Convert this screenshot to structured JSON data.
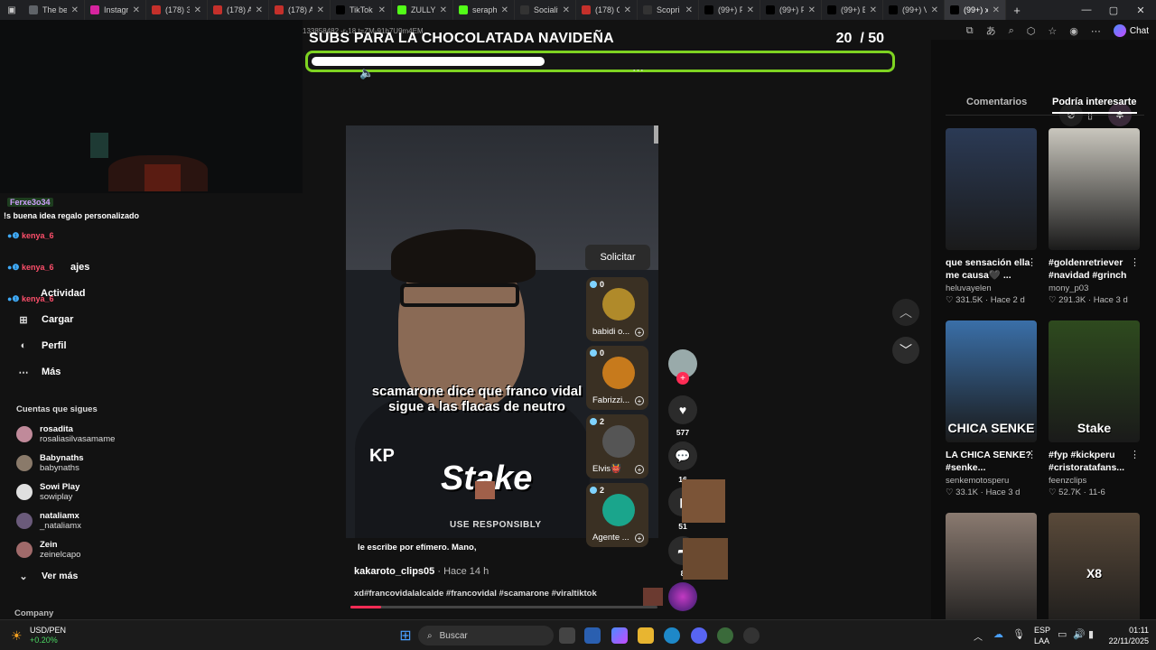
{
  "browser": {
    "tabs": [
      {
        "label": "The be",
        "color": "#5f6368"
      },
      {
        "label": "Instagra",
        "color": "#d6249f"
      },
      {
        "label": "(178) 3",
        "color": "#c4302b"
      },
      {
        "label": "(178) Al",
        "color": "#c4302b"
      },
      {
        "label": "(178) Al",
        "color": "#c4302b"
      },
      {
        "label": "TikTok -",
        "color": "#000000"
      },
      {
        "label": "ZULLY",
        "color": "#53fc18"
      },
      {
        "label": "seraphi",
        "color": "#53fc18"
      },
      {
        "label": "Socialit",
        "color": "#333333"
      },
      {
        "label": "(178) C",
        "color": "#c4302b"
      },
      {
        "label": "Scopri I",
        "color": "#333333"
      },
      {
        "label": "(99+) Fr",
        "color": "#000000"
      },
      {
        "label": "(99+) Pi",
        "color": "#000000"
      },
      {
        "label": "(99+) Er",
        "color": "#000000"
      },
      {
        "label": "(99+) Vi",
        "color": "#000000"
      },
      {
        "label": "(99+) xc",
        "color": "#000000",
        "active": true
      }
    ],
    "new_tab": "+",
    "url_fragment": "133858482 -r-18 t=ZM-91b7U9m4EM",
    "chat_label": "Chat"
  },
  "overlay": {
    "chat": [
      {
        "user": "Ferxe3o34",
        "text": "!s buena idea regalo personalizado"
      },
      {
        "user": "kenya_6",
        "text": ""
      },
      {
        "user": "kenya_6",
        "text": ""
      },
      {
        "user": "kenya_6",
        "text": ""
      }
    ]
  },
  "sidebar": {
    "nav_partial": [
      {
        "label": "ajes"
      },
      {
        "label": "Actividad"
      }
    ],
    "nav": [
      {
        "label": "Cargar",
        "icon": "upload-icon"
      },
      {
        "label": "Perfil",
        "icon": "profile-icon"
      },
      {
        "label": "Más",
        "icon": "more-icon"
      }
    ],
    "following_title": "Cuentas que sigues",
    "following": [
      {
        "name": "rosadita",
        "handle": "rosaliasilvasamame"
      },
      {
        "name": "Babynaths",
        "handle": "babynaths"
      },
      {
        "name": "Sowi Play",
        "handle": "sowiplay"
      },
      {
        "name": "nataliamx",
        "handle": "_nataliamx"
      },
      {
        "name": "Zein",
        "handle": "zeinelcapo"
      }
    ],
    "see_more": "Ver más",
    "company": "Company"
  },
  "goal": {
    "title": "SUBS PARA LA CHOCOLATADA NAVIDEÑA",
    "current": "20",
    "target": "/ 50",
    "fraction": 0.4,
    "color": "#7ed321"
  },
  "video": {
    "caption": "scamarone dice que franco vidal sigue a las flacas de neutro",
    "brand": "Stake",
    "brand_sub": "USE RESPONSIBLY",
    "kp": "KP",
    "subtitle": "le escribe por efímero. Mano,",
    "author": "kakaroto_clips05",
    "ago": "· Hace 14 h",
    "tags": "xd#francovidalalcalde #francovidal #scamarone #viraltiktok",
    "progress": 0.1,
    "request_label": "Solicitar",
    "guests": [
      {
        "count": "0",
        "name": "babidi o...",
        "color": "#b08a2a"
      },
      {
        "count": "0",
        "name": "Fabrizzi...",
        "color": "#c77a1c"
      },
      {
        "count": "2",
        "name": "Elvis👹",
        "color": "#555"
      },
      {
        "count": "2",
        "name": "Agente ...",
        "color": "#1aa58c"
      }
    ],
    "likes": "577",
    "comments": "16",
    "saves": "51",
    "shares": "8"
  },
  "right_panel": {
    "tabs": [
      "Comentarios",
      "Podría interesarte"
    ],
    "active_tab": 1,
    "recs": [
      {
        "title": "que sensación ella me causa🖤 ...",
        "user": "heluvayelen",
        "likes": "331.5K",
        "ago": "Hace 2 d",
        "overlay": "",
        "color": "#2b3a55"
      },
      {
        "title": "#goldenretriever #navidad #grinch",
        "user": "mony_p03",
        "likes": "291.3K",
        "ago": "Hace 3 d",
        "overlay": "",
        "color": "#c9c6bd"
      },
      {
        "title": "LA CHICA SENKE? #senke...",
        "user": "senkemotosperu",
        "likes": "33.1K",
        "ago": "Hace 3 d",
        "overlay": "CHICA SENKE",
        "color": "#3a6fa8"
      },
      {
        "title": "#fyp #kickperu #cristoratafans...",
        "user": "feenzclips",
        "likes": "52.7K",
        "ago": "11-6",
        "overlay": "Stake",
        "color": "#2e4a1e"
      },
      {
        "title": "",
        "user": "",
        "likes": "",
        "ago": "",
        "overlay": "",
        "color": "#8a7a70"
      },
      {
        "title": "",
        "user": "",
        "likes": "",
        "ago": "",
        "overlay": "X8",
        "color": "#5a4a3a"
      }
    ]
  },
  "taskbar": {
    "ticker_symbol": "USD/PEN",
    "ticker_change": "+0.20%",
    "search_label": "Buscar",
    "lang_top": "ESP",
    "lang_bottom": "LAA",
    "time": "01:11",
    "date": "22/11/2025"
  }
}
